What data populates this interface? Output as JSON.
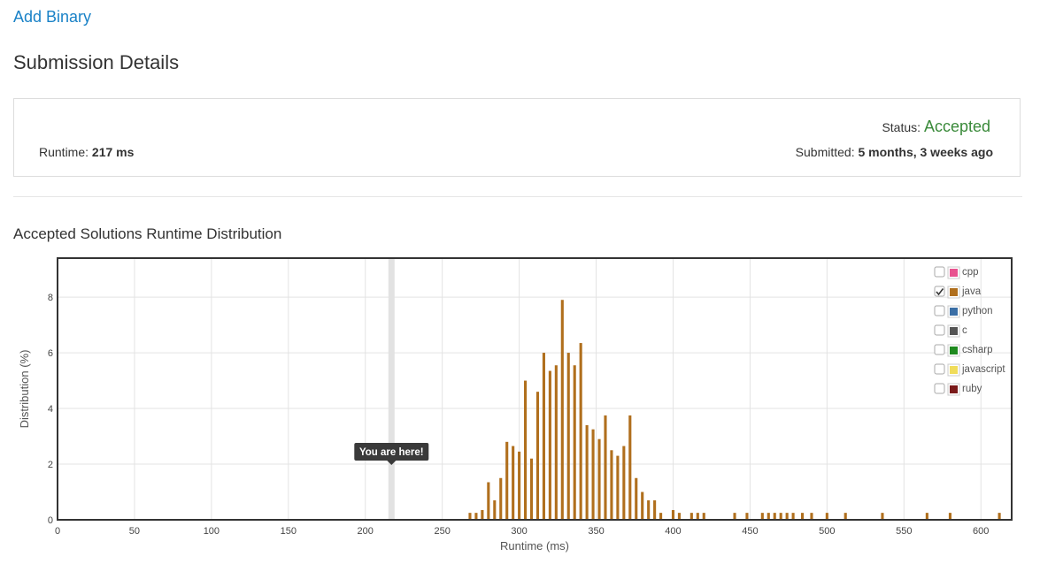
{
  "problem": {
    "title": "Add Binary"
  },
  "page": {
    "title": "Submission Details"
  },
  "details": {
    "runtime_label": "Runtime:",
    "runtime_value": "217 ms",
    "status_label": "Status:",
    "status_value": "Accepted",
    "submitted_label": "Submitted:",
    "submitted_value": "5 months, 3 weeks ago"
  },
  "distribution": {
    "title": "Accepted Solutions Runtime Distribution"
  },
  "colors": {
    "cpp": "#e8538f",
    "java": "#b06f1d",
    "python": "#3a6ea5",
    "c": "#555555",
    "csharp": "#1e8a1e",
    "javascript": "#f0dc5a",
    "ruby": "#7a1a1a",
    "accepted": "#3a8a3a",
    "link": "#1a82c7"
  },
  "chart_data": {
    "type": "bar",
    "xlabel": "Runtime (ms)",
    "ylabel": "Distribution (%)",
    "xlim": [
      0,
      620
    ],
    "ylim": [
      0,
      9.4
    ],
    "x_ticks": [
      0,
      50,
      100,
      150,
      200,
      250,
      300,
      350,
      400,
      450,
      500,
      550,
      600
    ],
    "y_ticks": [
      0,
      2,
      4,
      6,
      8
    ],
    "grid": true,
    "legend": {
      "position": "top-right",
      "items": [
        {
          "name": "cpp",
          "checked": false
        },
        {
          "name": "java",
          "checked": true
        },
        {
          "name": "python",
          "checked": false
        },
        {
          "name": "c",
          "checked": false
        },
        {
          "name": "csharp",
          "checked": false
        },
        {
          "name": "javascript",
          "checked": false
        },
        {
          "name": "ruby",
          "checked": false
        }
      ]
    },
    "marker": {
      "x": 217,
      "label": "You are here!"
    },
    "series": [
      {
        "name": "java",
        "color": "#b06f1d",
        "points": [
          [
            268,
            0.25
          ],
          [
            272,
            0.25
          ],
          [
            276,
            0.35
          ],
          [
            280,
            1.35
          ],
          [
            284,
            0.7
          ],
          [
            288,
            1.5
          ],
          [
            292,
            2.8
          ],
          [
            296,
            2.65
          ],
          [
            300,
            2.45
          ],
          [
            304,
            5.0
          ],
          [
            308,
            2.2
          ],
          [
            312,
            4.6
          ],
          [
            316,
            6.0
          ],
          [
            320,
            5.35
          ],
          [
            324,
            5.55
          ],
          [
            328,
            7.9
          ],
          [
            332,
            6.0
          ],
          [
            336,
            5.55
          ],
          [
            340,
            6.35
          ],
          [
            344,
            3.4
          ],
          [
            348,
            3.25
          ],
          [
            352,
            2.9
          ],
          [
            356,
            3.75
          ],
          [
            360,
            2.5
          ],
          [
            364,
            2.3
          ],
          [
            368,
            2.65
          ],
          [
            372,
            3.75
          ],
          [
            376,
            1.5
          ],
          [
            380,
            1.0
          ],
          [
            384,
            0.7
          ],
          [
            388,
            0.7
          ],
          [
            392,
            0.25
          ],
          [
            400,
            0.35
          ],
          [
            404,
            0.25
          ],
          [
            412,
            0.25
          ],
          [
            416,
            0.25
          ],
          [
            420,
            0.25
          ],
          [
            440,
            0.25
          ],
          [
            448,
            0.25
          ],
          [
            458,
            0.25
          ],
          [
            462,
            0.25
          ],
          [
            466,
            0.25
          ],
          [
            470,
            0.25
          ],
          [
            474,
            0.25
          ],
          [
            478,
            0.25
          ],
          [
            484,
            0.25
          ],
          [
            490,
            0.25
          ],
          [
            500,
            0.25
          ],
          [
            512,
            0.25
          ],
          [
            536,
            0.25
          ],
          [
            565,
            0.25
          ],
          [
            580,
            0.25
          ],
          [
            612,
            0.25
          ]
        ]
      }
    ]
  }
}
